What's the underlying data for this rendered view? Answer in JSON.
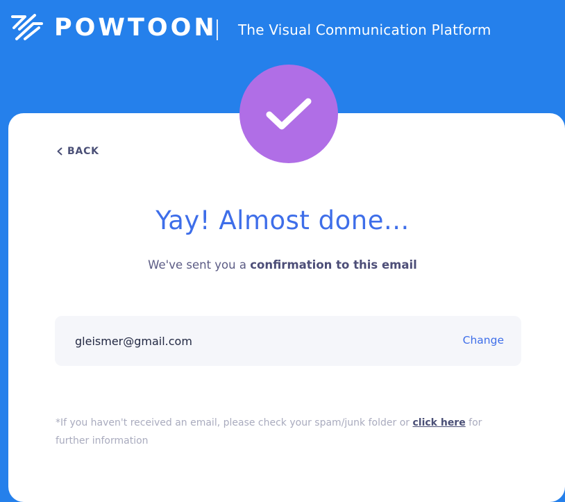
{
  "header": {
    "brand": "POWTOON",
    "tagline": "The Visual Communication Platform"
  },
  "card": {
    "back_label": "BACK",
    "heading": "Yay! Almost done...",
    "subheading_prefix": "We've sent you a ",
    "subheading_bold": "confirmation to this email",
    "email": "gleismer@gmail.com",
    "change_label": "Change",
    "footnote_prefix": "*If you haven't received an email, please check your spam/junk folder or ",
    "footnote_link": "click here",
    "footnote_suffix": " for further information"
  },
  "colors": {
    "background": "#2580eb",
    "accent": "#3e6ee9",
    "check_circle": "#b06ee6"
  },
  "icons": {
    "logo": "powtoon-logo-icon",
    "check": "check-icon",
    "back": "chevron-left-icon"
  }
}
